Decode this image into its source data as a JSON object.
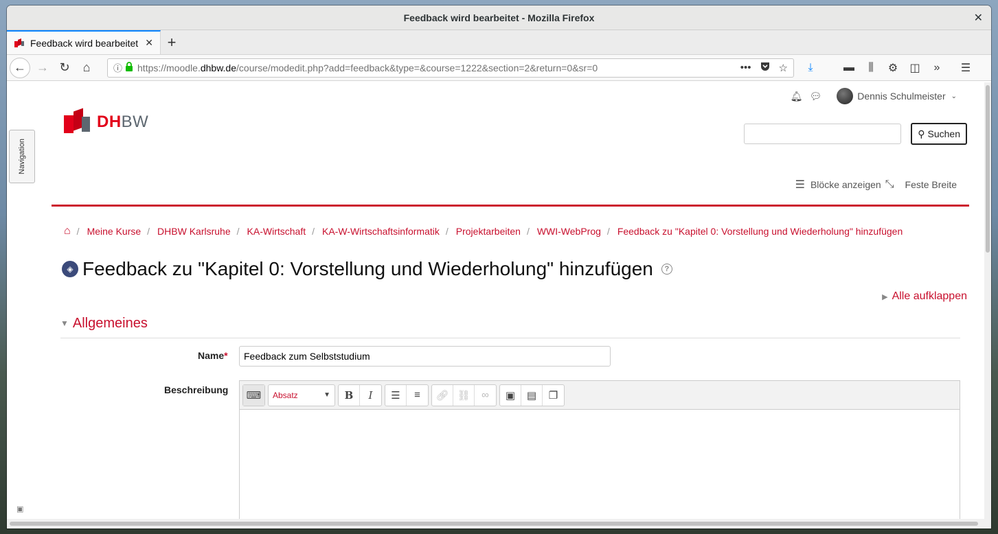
{
  "window": {
    "title": "Feedback wird bearbeitet - Mozilla Firefox"
  },
  "tab": {
    "label": "Feedback wird bearbeitet"
  },
  "urlbar": {
    "prefix": "https://moodle.",
    "host": "dhbw.de",
    "path": "/course/modedit.php?add=feedback&type=&course=1222&section=2&return=0&sr=0"
  },
  "user": {
    "name": "Dennis Schulmeister"
  },
  "nav_drawer": {
    "label": "Navigation"
  },
  "logo": {
    "dh": "DH",
    "bw": "BW"
  },
  "search": {
    "placeholder": "",
    "button": "Suchen"
  },
  "layout": {
    "show_blocks": "Blöcke anzeigen",
    "fixed_width": "Feste Breite"
  },
  "breadcrumb": [
    "Meine Kurse",
    "DHBW Karlsruhe",
    "KA-Wirtschaft",
    "KA-W-Wirtschaftsinformatik",
    "Projektarbeiten",
    "WWI-WebProg",
    "Feedback zu \"Kapitel 0: Vorstellung und Wiederholung\" hinzufügen"
  ],
  "heading": "Feedback zu \"Kapitel 0: Vorstellung und Wiederholung\" hinzufügen",
  "expand_all": "Alle aufklappen",
  "section_title": "Allgemeines",
  "form": {
    "name_label": "Name",
    "required_mark": "*",
    "name_value": "Feedback zum Selbststudium",
    "description_label": "Beschreibung"
  },
  "editor": {
    "paragraph_select": "Absatz"
  }
}
